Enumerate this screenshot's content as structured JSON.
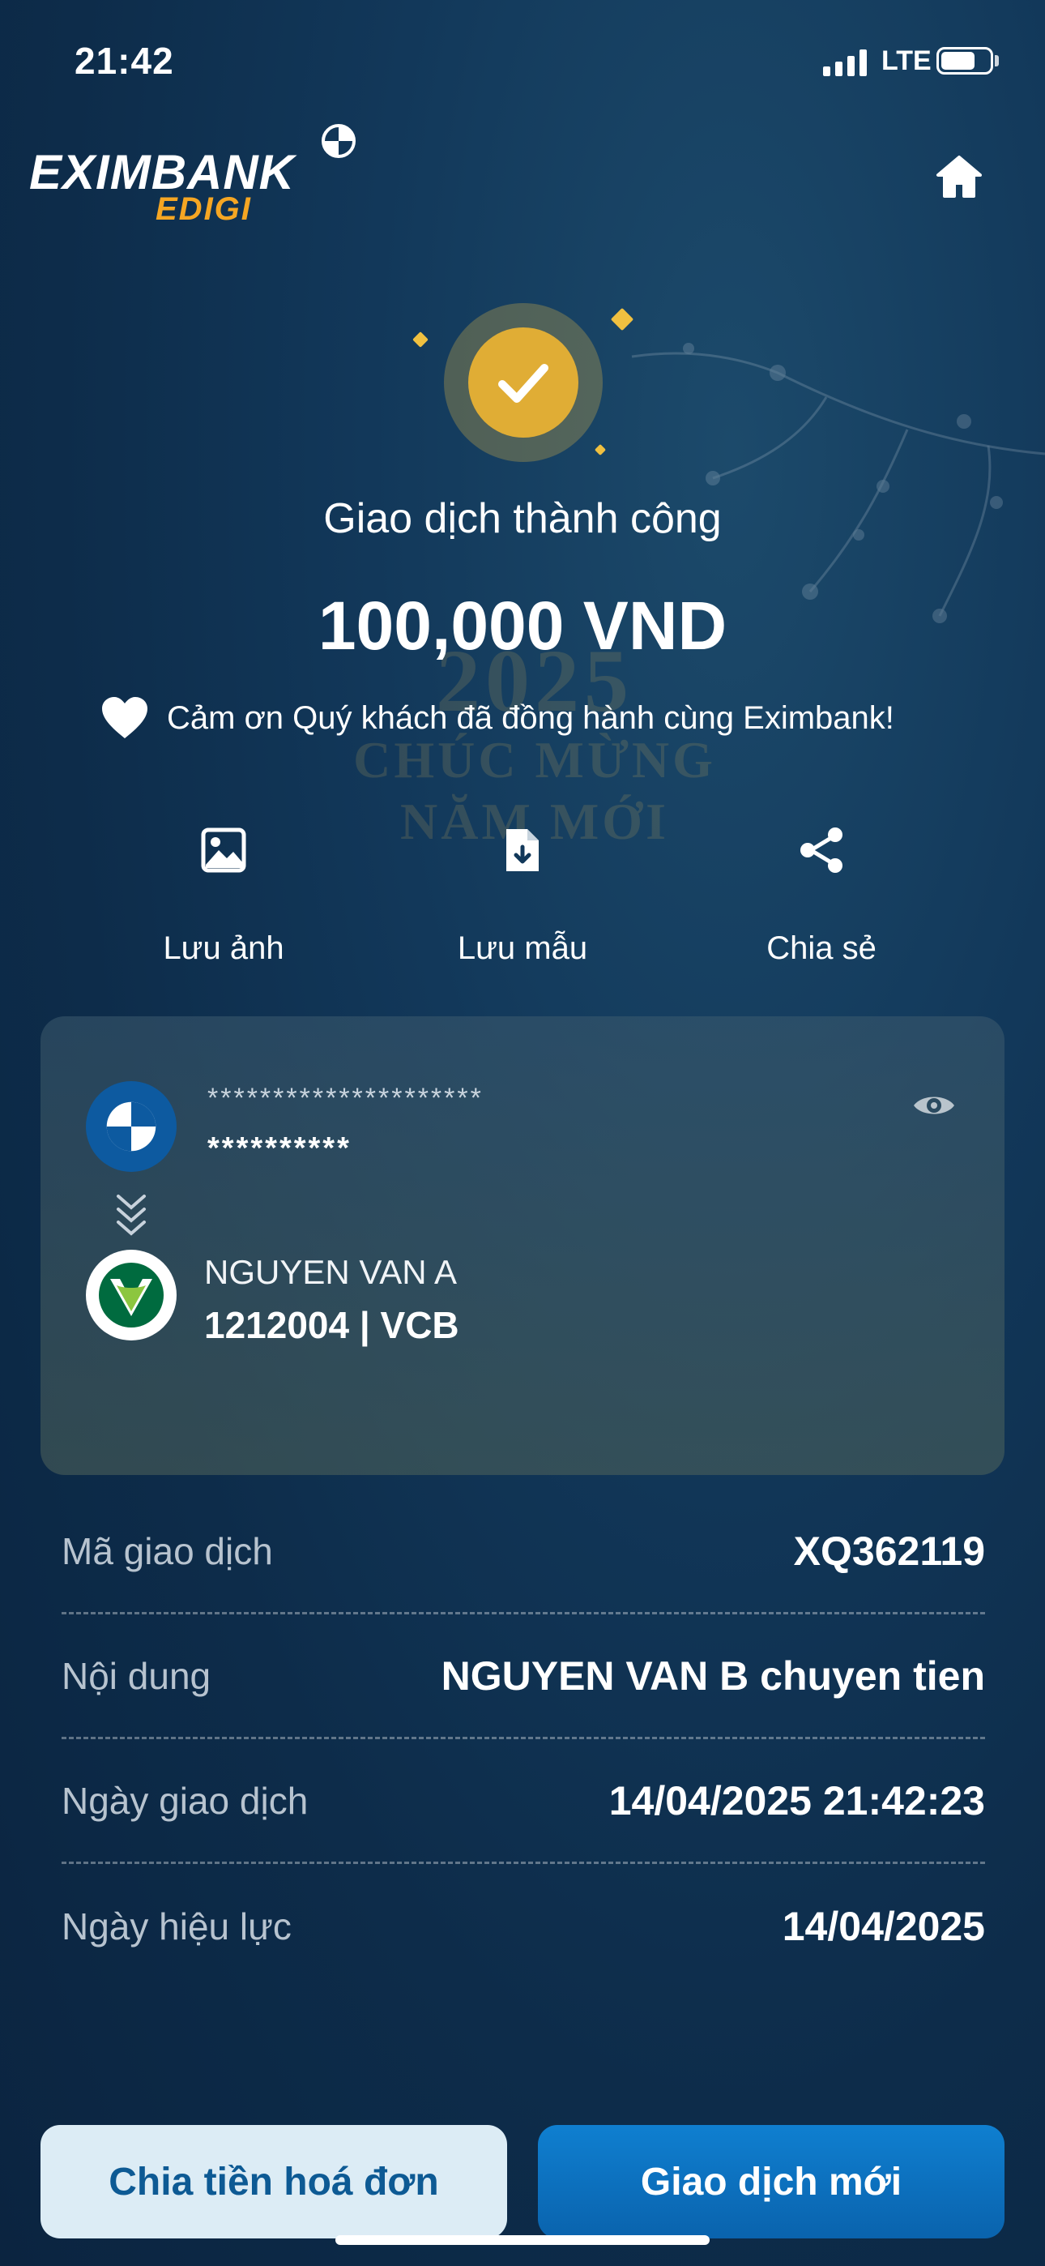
{
  "status_bar": {
    "time": "21:42",
    "network": "LTE"
  },
  "header": {
    "logo_text": "EXIMBANK",
    "logo_sub": "EDIGI"
  },
  "decor": {
    "year": "2025",
    "greeting_line1": "CHÚC MỪNG",
    "greeting_line2": "NĂM MỚI"
  },
  "result": {
    "status": "Giao dịch thành công",
    "amount": "100,000 VND",
    "thanks": "Cảm ơn Quý khách đã đồng hành cùng Eximbank!"
  },
  "actions": [
    {
      "label": "Lưu ảnh",
      "icon": "image-icon"
    },
    {
      "label": "Lưu mẫu",
      "icon": "save-template-icon"
    },
    {
      "label": "Chia sẻ",
      "icon": "share-icon"
    }
  ],
  "transfer": {
    "source_account_masked": "*********************",
    "source_name_masked": "**********",
    "recipient_name": "NGUYEN VAN A",
    "recipient_account": "1212004 | VCB"
  },
  "details": [
    {
      "label": "Mã giao dịch",
      "value": "XQ362119"
    },
    {
      "label": "Nội dung",
      "value": "NGUYEN VAN B chuyen tien"
    },
    {
      "label": "Ngày giao dịch",
      "value": "14/04/2025 21:42:23"
    },
    {
      "label": "Ngày hiệu lực",
      "value": "14/04/2025"
    }
  ],
  "buttons": {
    "split_bill": "Chia tiền hoá đơn",
    "new_transaction": "Giao dịch mới"
  },
  "colors": {
    "accent_gold": "#e0ad35",
    "primary_blue": "#0a63ad",
    "background": "#0d2c4a"
  }
}
